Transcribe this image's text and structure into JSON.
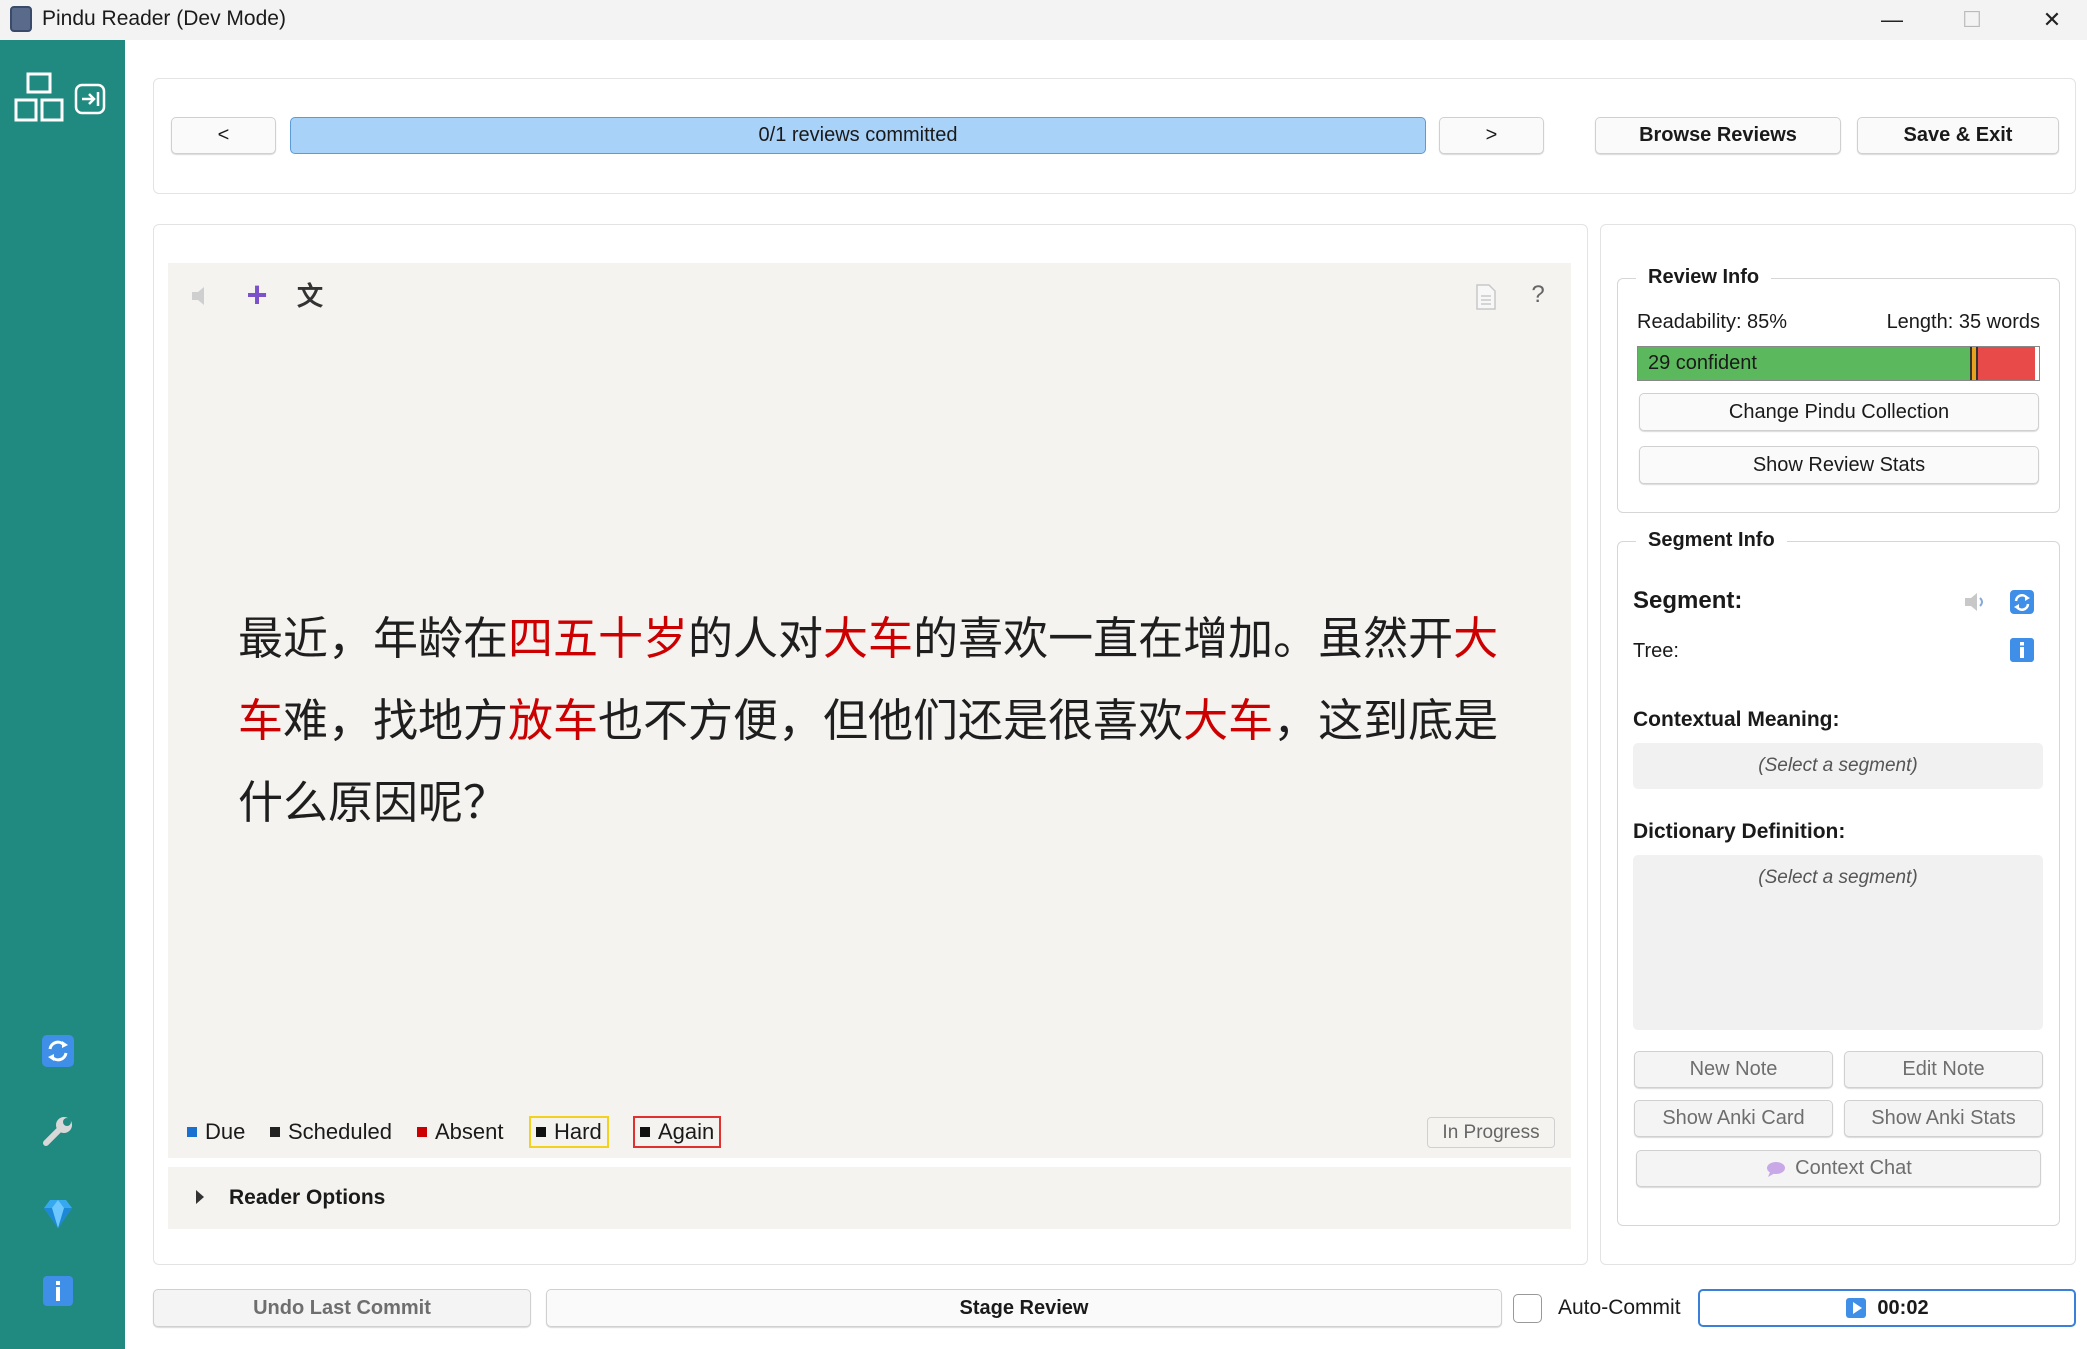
{
  "window": {
    "title": "Pindu Reader (Dev Mode)",
    "min_symbol": "—",
    "max_symbol": "☐",
    "close_symbol": "✕"
  },
  "sidebar": {
    "icons": [
      "layout-icon",
      "exit-icon",
      "sync-icon",
      "wrench-icon",
      "gem-icon",
      "info-icon"
    ]
  },
  "nav": {
    "prev_label": "<",
    "next_label": ">",
    "progress_text": "0/1 reviews committed",
    "browse_label": "Browse Reviews",
    "save_exit_label": "Save & Exit"
  },
  "reader": {
    "toolbar": {
      "add_symbol": "+",
      "translate_symbol": "文",
      "help_symbol": "?"
    },
    "text_segments": [
      {
        "t": "最近，年龄在",
        "hl": false
      },
      {
        "t": "四五十岁",
        "hl": true
      },
      {
        "t": "的人对",
        "hl": false
      },
      {
        "t": "大车",
        "hl": true
      },
      {
        "t": "的喜欢一直在增加。虽然开",
        "hl": false
      },
      {
        "t": "大车",
        "hl": true
      },
      {
        "t": "难，找地方",
        "hl": false
      },
      {
        "t": "放车",
        "hl": true
      },
      {
        "t": "也不方便，但他们还是很喜欢",
        "hl": false
      },
      {
        "t": "大车",
        "hl": true
      },
      {
        "t": "，这到底是什么原因呢？",
        "hl": false
      }
    ],
    "legend": {
      "due": "Due",
      "scheduled": "Scheduled",
      "absent": "Absent",
      "hard": "Hard",
      "again": "Again"
    },
    "legend_colors": {
      "due": "#1a6fd1",
      "scheduled": "#222222",
      "absent": "#cc0000",
      "hard_border": "#f2d21c",
      "again_border": "#e03030"
    },
    "status": "In Progress",
    "options_label": "Reader Options"
  },
  "review_info": {
    "title": "Review Info",
    "readability": "Readability: 85%",
    "length": "Length: 35 words",
    "confident_label": "29 confident",
    "bar_fractions": {
      "confident": 0.828,
      "hard": 0.02,
      "absent": 0.142
    },
    "bar_colors": {
      "confident": "#5cb85c",
      "hard": "#e8a020",
      "absent": "#e84a4a"
    },
    "change_collection_label": "Change Pindu Collection",
    "show_stats_label": "Show Review Stats"
  },
  "segment_info": {
    "title": "Segment Info",
    "segment_label": "Segment:",
    "tree_label": "Tree:",
    "contextual_label": "Contextual Meaning:",
    "contextual_placeholder": "(Select a segment)",
    "dictionary_label": "Dictionary Definition:",
    "dictionary_placeholder": "(Select a segment)",
    "new_note": "New Note",
    "edit_note": "Edit Note",
    "show_anki_card": "Show Anki Card",
    "show_anki_stats": "Show Anki Stats",
    "context_chat": "Context Chat"
  },
  "bottom": {
    "undo_label": "Undo Last Commit",
    "stage_label": "Stage Review",
    "auto_commit_label": "Auto-Commit",
    "auto_commit_checked": false,
    "timer": "00:02"
  }
}
